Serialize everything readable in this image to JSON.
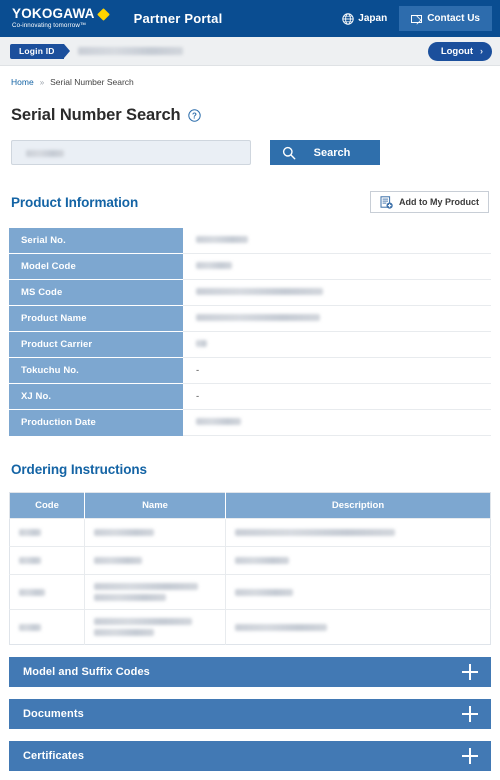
{
  "header": {
    "brand_name": "YOKOGAWA",
    "brand_tagline": "Co-innovating tomorrow™",
    "portal_title": "Partner Portal",
    "language": "Japan",
    "contact_label": "Contact Us",
    "globe_icon": "globe-icon",
    "envelope_icon": "envelope-icon",
    "diamond_icon": "yellow-diamond-icon"
  },
  "loginbar": {
    "login_id_label": "Login ID",
    "login_id_value": "",
    "logout_label": "Logout",
    "logout_chevron": "›"
  },
  "breadcrumb": {
    "home": "Home",
    "separator": "»",
    "current": "Serial Number Search"
  },
  "page": {
    "title": "Serial Number Search",
    "help_icon": "question-mark-circle-icon"
  },
  "search": {
    "value": "",
    "placeholder": "",
    "button_label": "Search",
    "search_icon": "magnifier-icon"
  },
  "product_information": {
    "section_title": "Product Information",
    "add_button_label": "Add to My Product",
    "add_button_icon": "document-plus-icon",
    "rows": [
      {
        "label": "Serial No.",
        "value": "",
        "redacted": true,
        "redact_width": 52
      },
      {
        "label": "Model Code",
        "value": "",
        "redacted": true,
        "redact_width": 36
      },
      {
        "label": "MS Code",
        "value": "",
        "redacted": true,
        "redact_width": 127
      },
      {
        "label": "Product Name",
        "value": "",
        "redacted": true,
        "redact_width": 124
      },
      {
        "label": "Product Carrier",
        "value": "",
        "redacted": true,
        "redact_width": 11
      },
      {
        "label": "Tokuchu No.",
        "value": "-",
        "redacted": false,
        "redact_width": 0
      },
      {
        "label": "XJ No.",
        "value": "-",
        "redacted": false,
        "redact_width": 0
      },
      {
        "label": "Production Date",
        "value": "",
        "redacted": true,
        "redact_width": 45
      }
    ]
  },
  "ordering_instructions": {
    "section_title": "Ordering Instructions",
    "columns": [
      "Code",
      "Name",
      "Description"
    ],
    "rows": [
      {
        "code_w": [
          22
        ],
        "name_w": [
          60
        ],
        "desc_w": [
          160
        ]
      },
      {
        "code_w": [
          22
        ],
        "name_w": [
          48
        ],
        "desc_w": [
          54
        ]
      },
      {
        "code_w": [
          26
        ],
        "name_w": [
          104,
          72
        ],
        "desc_w": [
          58
        ]
      },
      {
        "code_w": [
          22
        ],
        "name_w": [
          98,
          60
        ],
        "desc_w": [
          92
        ]
      }
    ]
  },
  "accordions": [
    {
      "label": "Model and Suffix Codes",
      "icon": "plus-icon"
    },
    {
      "label": "Documents",
      "icon": "plus-icon"
    },
    {
      "label": "Certificates",
      "icon": "plus-icon"
    }
  ],
  "colors": {
    "header_blue": "#0a4d91",
    "contact_blue": "#2d6cad",
    "accent_yellow": "#ffd400",
    "link_blue": "#1464a5",
    "table_header_blue": "#7da7d0",
    "accordion_blue": "#4279b4",
    "search_button_blue": "#2f6fac",
    "login_pill_blue": "#1b4f9c"
  }
}
